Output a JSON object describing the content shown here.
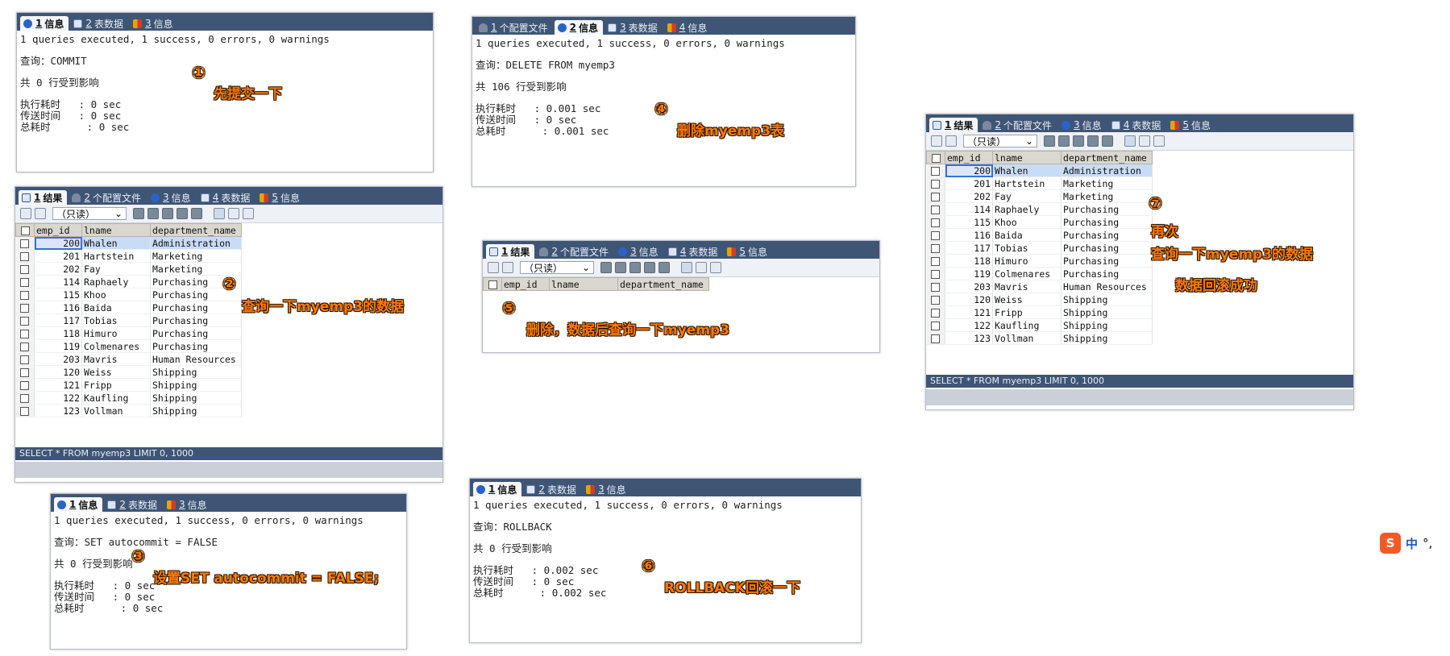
{
  "colors": {
    "accent": "#3f5575",
    "annotation": "#ff7a00",
    "selection": "#c9dcf6"
  },
  "p1": {
    "tabs": [
      {
        "num": "1",
        "label": "信息",
        "icon": "info-icon"
      },
      {
        "num": "2",
        "label": "表数据",
        "icon": "table-icon"
      },
      {
        "num": "3",
        "label": "信息",
        "icon": "message-icon"
      }
    ],
    "lines": [
      "1 queries executed, 1 success, 0 errors, 0 warnings",
      "",
      "查询：COMMIT",
      "",
      "共 0 行受到影响",
      "",
      "执行耗时   : 0 sec",
      "传送时间   : 0 sec",
      "总耗时      : 0 sec"
    ]
  },
  "p2": {
    "tabs": [
      {
        "num": "1",
        "label": "个配置文件",
        "icon": "config-icon"
      },
      {
        "num": "2",
        "label": "信息",
        "icon": "info-icon"
      },
      {
        "num": "3",
        "label": "表数据",
        "icon": "table-icon"
      },
      {
        "num": "4",
        "label": "信息",
        "icon": "message-icon"
      }
    ],
    "lines": [
      "1 queries executed, 1 success, 0 errors, 0 warnings",
      "",
      "查询：DELETE FROM myemp3",
      "",
      "共 106 行受到影响",
      "",
      "执行耗时   : 0.001 sec",
      "传送时间   : 0 sec",
      "总耗时      : 0.001 sec"
    ]
  },
  "p3": {
    "tabs": [
      {
        "num": "1",
        "label": "结果",
        "icon": "table-icon"
      },
      {
        "num": "2",
        "label": "个配置文件",
        "icon": "config-icon"
      },
      {
        "num": "3",
        "label": "信息",
        "icon": "info-icon"
      },
      {
        "num": "4",
        "label": "表数据",
        "icon": "table-icon"
      },
      {
        "num": "5",
        "label": "信息",
        "icon": "message-icon"
      }
    ],
    "mode": "（只读）",
    "status": "SELECT * FROM myemp3 LIMIT 0, 1000"
  },
  "p4": {
    "tabs": [
      {
        "num": "1",
        "label": "结果",
        "icon": "table-icon"
      },
      {
        "num": "2",
        "label": "个配置文件",
        "icon": "config-icon"
      },
      {
        "num": "3",
        "label": "信息",
        "icon": "info-icon"
      },
      {
        "num": "4",
        "label": "表数据",
        "icon": "table-icon"
      },
      {
        "num": "5",
        "label": "信息",
        "icon": "message-icon"
      }
    ],
    "mode": "（只读）"
  },
  "p5": {
    "tabs": [
      {
        "num": "1",
        "label": "结果",
        "icon": "table-icon"
      },
      {
        "num": "2",
        "label": "个配置文件",
        "icon": "config-icon"
      },
      {
        "num": "3",
        "label": "信息",
        "icon": "info-icon"
      },
      {
        "num": "4",
        "label": "表数据",
        "icon": "table-icon"
      },
      {
        "num": "5",
        "label": "信息",
        "icon": "message-icon"
      }
    ],
    "mode": "（只读）",
    "status": "SELECT * FROM myemp3 LIMIT 0, 1000"
  },
  "p6": {
    "tabs": [
      {
        "num": "1",
        "label": "信息",
        "icon": "info-icon"
      },
      {
        "num": "2",
        "label": "表数据",
        "icon": "table-icon"
      },
      {
        "num": "3",
        "label": "信息",
        "icon": "message-icon"
      }
    ],
    "lines": [
      "1 queries executed, 1 success, 0 errors, 0 warnings",
      "",
      "查询：SET autocommit = FALSE",
      "",
      "共 0 行受到影响",
      "",
      "执行耗时   : 0 sec",
      "传送时间   : 0 sec",
      "总耗时      : 0 sec"
    ]
  },
  "p7": {
    "tabs": [
      {
        "num": "1",
        "label": "信息",
        "icon": "info-icon"
      },
      {
        "num": "2",
        "label": "表数据",
        "icon": "table-icon"
      },
      {
        "num": "3",
        "label": "信息",
        "icon": "message-icon"
      }
    ],
    "lines": [
      "1 queries executed, 1 success, 0 errors, 0 warnings",
      "",
      "查询：ROLLBACK",
      "",
      "共 0 行受到影响",
      "",
      "执行耗时   : 0.002 sec",
      "传送时间   : 0 sec",
      "总耗时      : 0.002 sec"
    ]
  },
  "columns": [
    "emp_id",
    "lname",
    "department_name"
  ],
  "rows": [
    {
      "id": "200",
      "lname": "Whalen",
      "dept": "Administration"
    },
    {
      "id": "201",
      "lname": "Hartstein",
      "dept": "Marketing"
    },
    {
      "id": "202",
      "lname": "Fay",
      "dept": "Marketing"
    },
    {
      "id": "114",
      "lname": "Raphaely",
      "dept": "Purchasing"
    },
    {
      "id": "115",
      "lname": "Khoo",
      "dept": "Purchasing"
    },
    {
      "id": "116",
      "lname": "Baida",
      "dept": "Purchasing"
    },
    {
      "id": "117",
      "lname": "Tobias",
      "dept": "Purchasing"
    },
    {
      "id": "118",
      "lname": "Himuro",
      "dept": "Purchasing"
    },
    {
      "id": "119",
      "lname": "Colmenares",
      "dept": "Purchasing"
    },
    {
      "id": "203",
      "lname": "Mavris",
      "dept": "Human Resources"
    },
    {
      "id": "120",
      "lname": "Weiss",
      "dept": "Shipping"
    },
    {
      "id": "121",
      "lname": "Fripp",
      "dept": "Shipping"
    },
    {
      "id": "122",
      "lname": "Kaufling",
      "dept": "Shipping"
    },
    {
      "id": "123",
      "lname": "Vollman",
      "dept": "Shipping"
    }
  ],
  "annotations": {
    "m1": "①",
    "a1": "先提交一下",
    "m2": "②",
    "a2": "查询一下myemp3的数据",
    "m3": "③",
    "a3": "设置SET autocommit = FALSE;",
    "m4": "④",
    "a4": "删除myemp3表",
    "m5": "⑤",
    "a5": "删除，数据后查询一下myemp3",
    "m6": "⑥",
    "a6": "ROLLBACK回滚一下",
    "m7": "⑦",
    "a7a": "再次",
    "a7b": "查询一下myemp3的数据",
    "a7c": "数据回滚成功"
  },
  "ime": {
    "label": "中",
    "punct": "°,"
  }
}
